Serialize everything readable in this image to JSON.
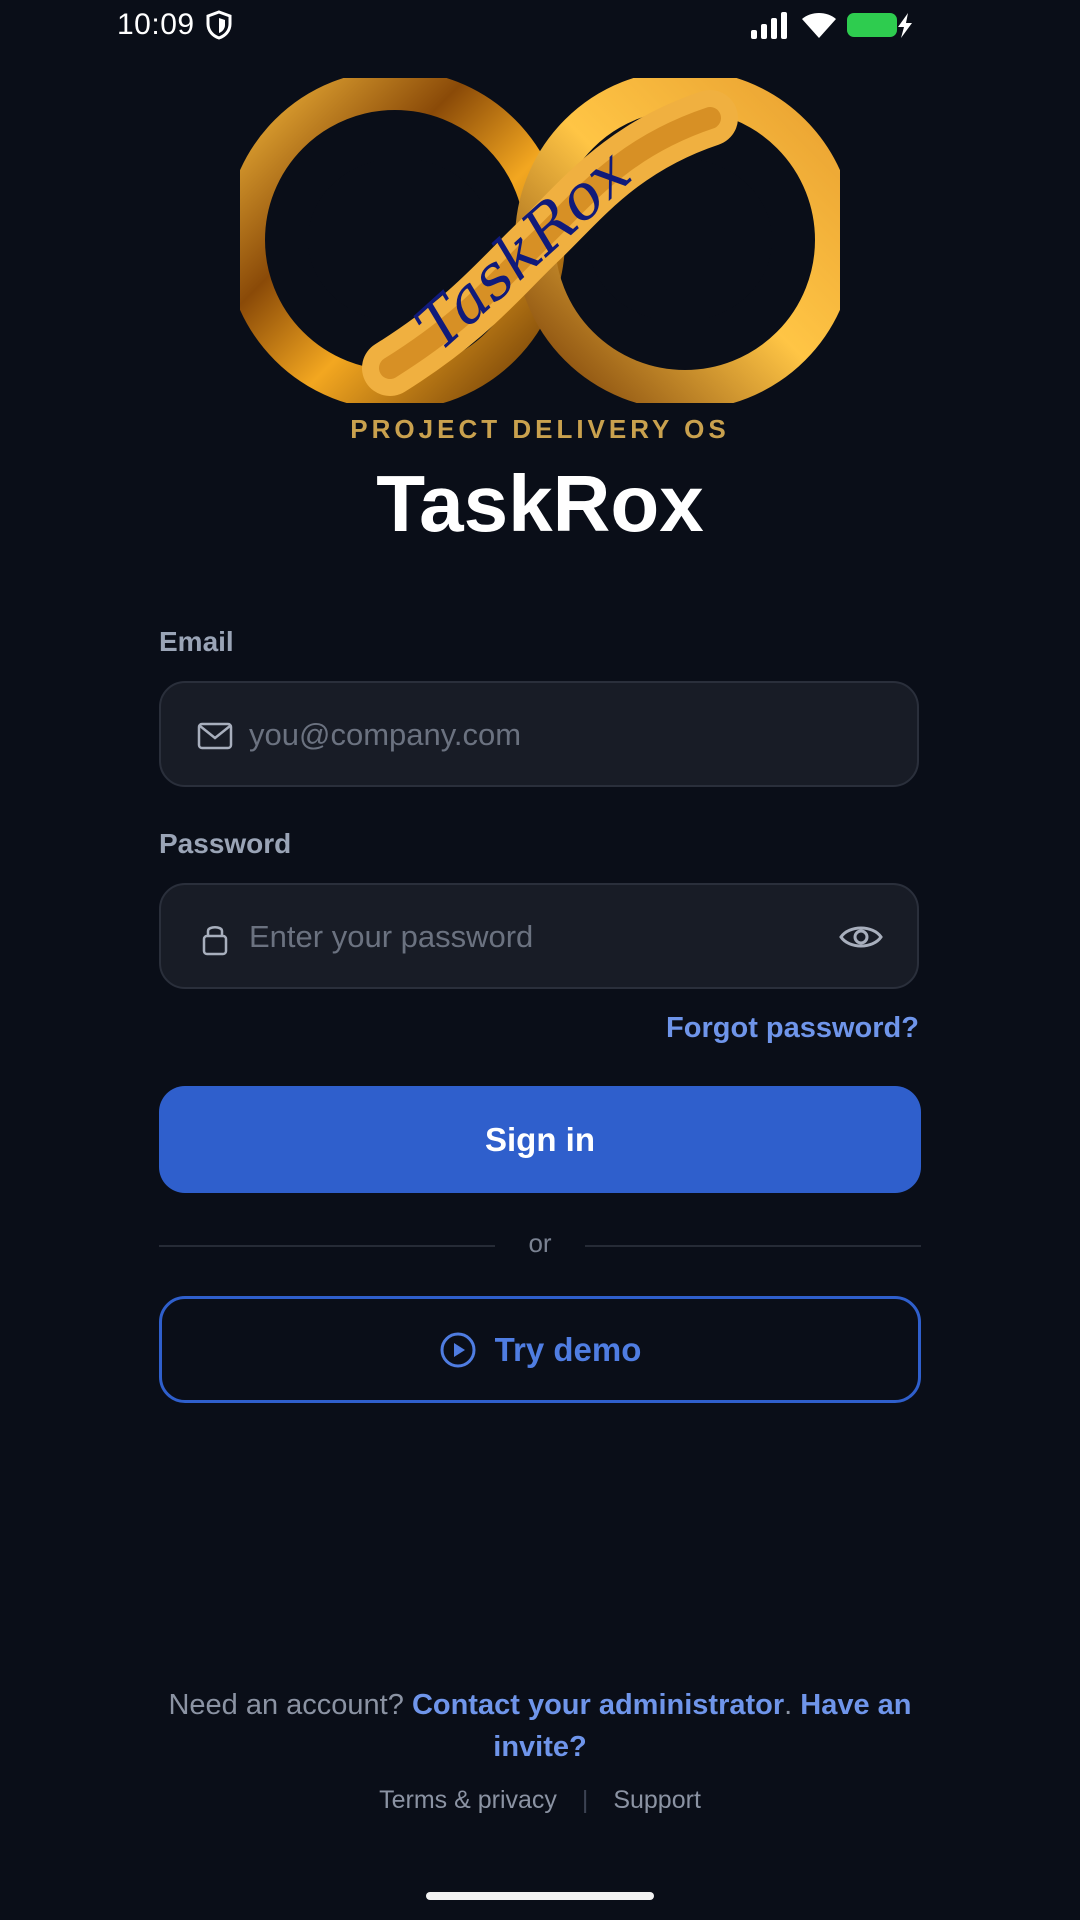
{
  "status_bar": {
    "time": "10:09"
  },
  "header": {
    "logo_text": "TaskRox",
    "tagline": "PROJECT DELIVERY OS",
    "title": "TaskRox"
  },
  "form": {
    "email_label": "Email",
    "email_placeholder": "you@company.com",
    "password_label": "Password",
    "password_placeholder": "Enter your password",
    "forgot_password": "Forgot password?",
    "sign_in": "Sign in",
    "divider": "or",
    "try_demo": "Try demo"
  },
  "footer": {
    "need_account": "Need an account?",
    "contact_admin": "Contact your administrator",
    "period": ".",
    "have_invite": "Have an invite?",
    "terms": "Terms & privacy",
    "separator": "|",
    "support": "Support"
  },
  "colors": {
    "background": "#0a0e18",
    "accent": "#2f5fcc",
    "link": "#6f95ea",
    "gold": "#c9a14e"
  },
  "icons": {
    "email": "mail-icon",
    "password": "lock-icon",
    "visibility": "eye-icon",
    "demo": "play-circle-icon"
  }
}
